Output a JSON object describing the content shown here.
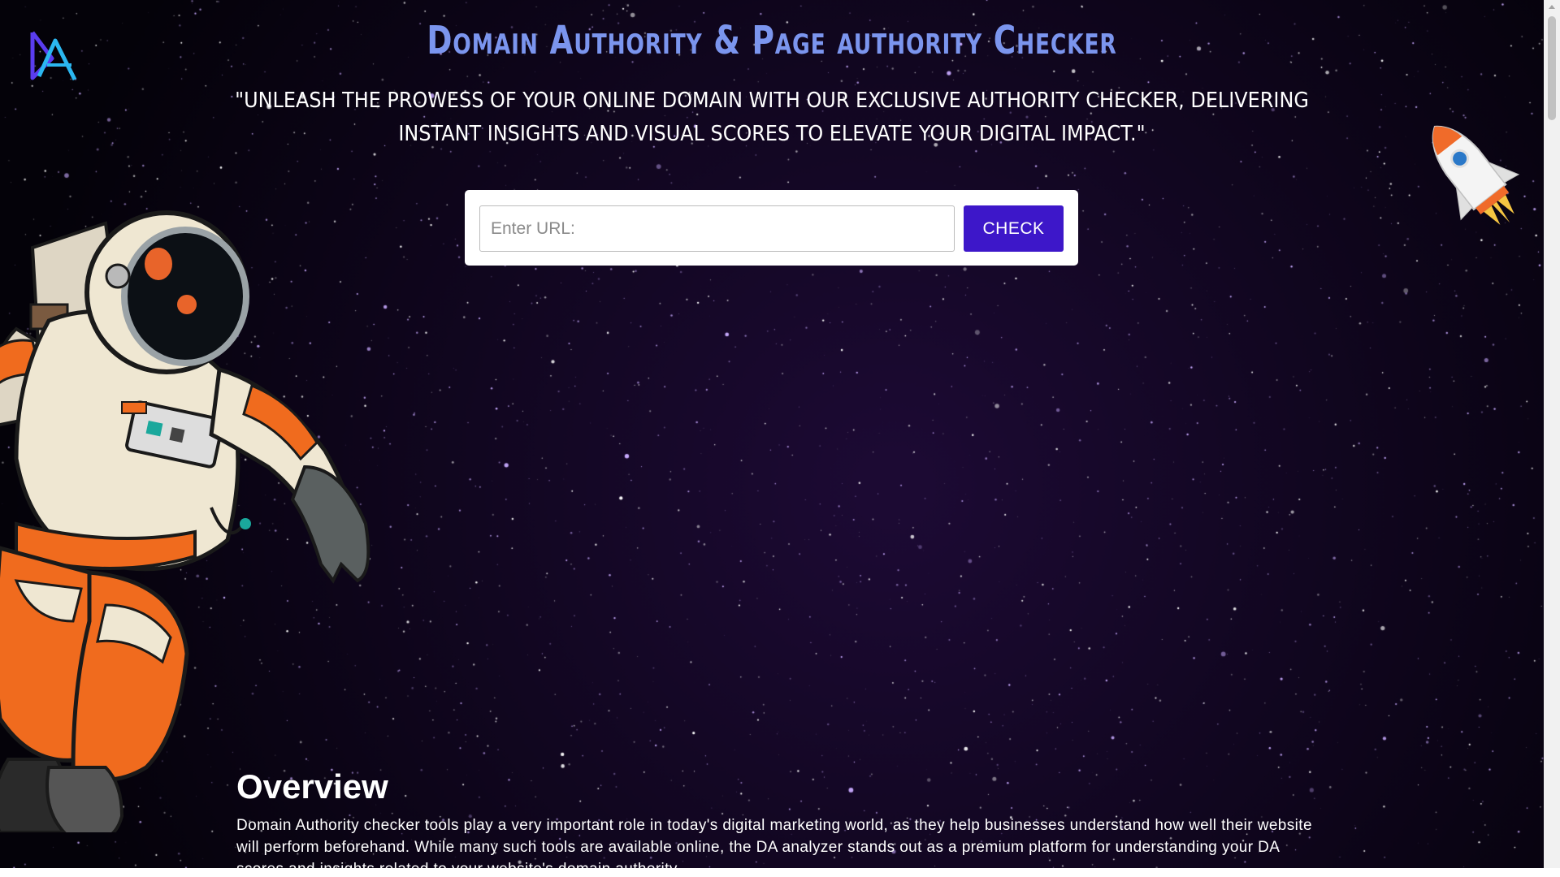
{
  "header": {
    "title": "Domain Authority & Page authority Checker",
    "tagline": "\"UNLEASH THE PROWESS OF YOUR ONLINE DOMAIN WITH OUR EXCLUSIVE AUTHORITY CHECKER, DELIVERING INSTANT INSIGHTS AND VISUAL SCORES TO ELEVATE YOUR DIGITAL IMPACT.\""
  },
  "search": {
    "placeholder": "Enter URL:",
    "value": "",
    "button_label": "CHECK"
  },
  "overview": {
    "heading": "Overview",
    "text": "Domain Authority checker tools play a very important role in today's digital marketing world, as they help businesses understand how well their website will perform beforehand. While many such tools are available online, the DA analyzer stands out as a premium platform for understanding your DA scores and insights related to your website's domain authority."
  },
  "icons": {
    "logo": "da-logo-icon",
    "astronaut": "astronaut-illustration",
    "rocket": "rocket-illustration"
  },
  "colors": {
    "background": "#05020c",
    "title": "#7b95ee",
    "button": "#3d17c9",
    "logo": "#5a3df0"
  }
}
